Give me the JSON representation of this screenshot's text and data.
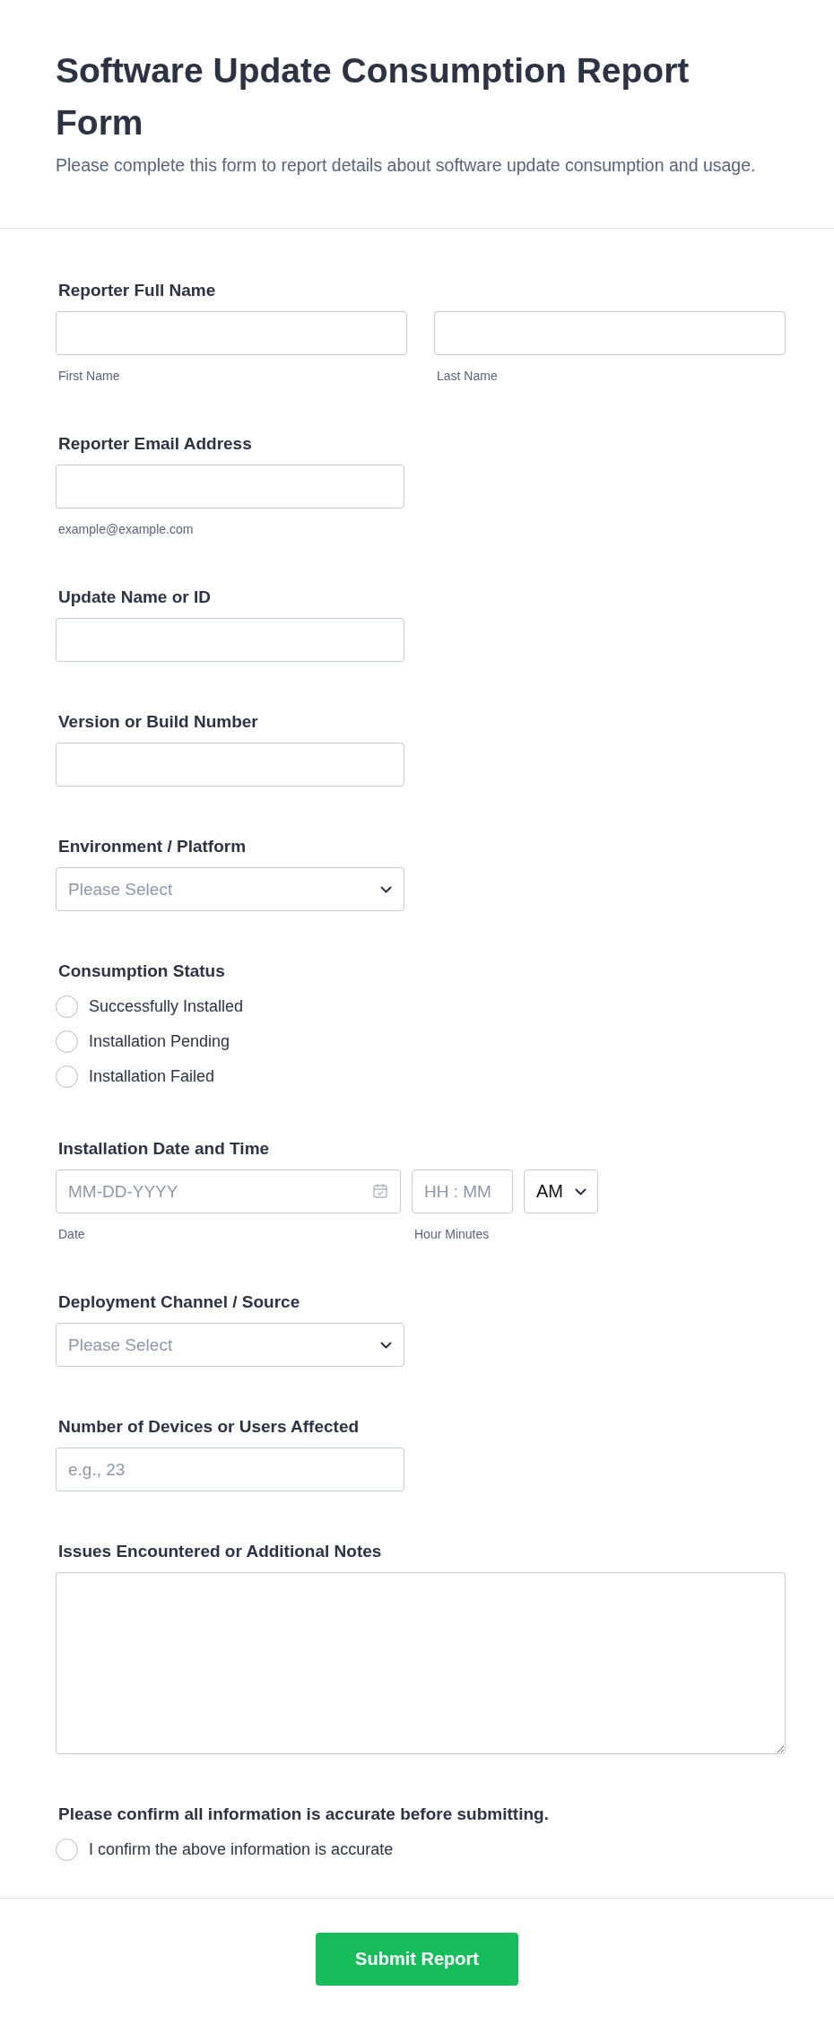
{
  "header": {
    "title": "Software Update Consumption Report Form",
    "description": "Please complete this form to report details about software update consumption and usage."
  },
  "fields": [
    {
      "kind": "name",
      "label": "Reporter Full Name",
      "parts": [
        {
          "sublabel": "First Name"
        },
        {
          "sublabel": "Last Name"
        }
      ]
    },
    {
      "kind": "text",
      "label": "Reporter Email Address",
      "sublabel": "example@example.com"
    },
    {
      "kind": "text",
      "label": "Update Name or ID"
    },
    {
      "kind": "text",
      "label": "Version or Build Number"
    },
    {
      "kind": "select",
      "label": "Environment / Platform",
      "placeholder": "Please Select"
    },
    {
      "kind": "radio",
      "label": "Consumption Status",
      "options": [
        {
          "label": "Successfully Installed",
          "selected": false
        },
        {
          "label": "Installation Pending",
          "selected": false
        },
        {
          "label": "Installation Failed",
          "selected": false
        }
      ]
    },
    {
      "kind": "datetime",
      "label": "Installation Date and Time",
      "date_placeholder": "MM-DD-YYYY",
      "date_sublabel": "Date",
      "time_placeholder": "HH : MM",
      "time_sublabel": "Hour Minutes",
      "ampm": "AM"
    },
    {
      "kind": "select",
      "label": "Deployment Channel / Source",
      "placeholder": "Please Select"
    },
    {
      "kind": "text",
      "label": "Number of Devices or Users Affected",
      "placeholder": "e.g., 23"
    },
    {
      "kind": "textarea",
      "label": "Issues Encountered or Additional Notes"
    },
    {
      "kind": "confirm",
      "label": "Please confirm all information is accurate before submitting.",
      "option": {
        "label": "I confirm the above information is accurate",
        "checked": false
      }
    }
  ],
  "submit": {
    "label": "Submit Report"
  }
}
